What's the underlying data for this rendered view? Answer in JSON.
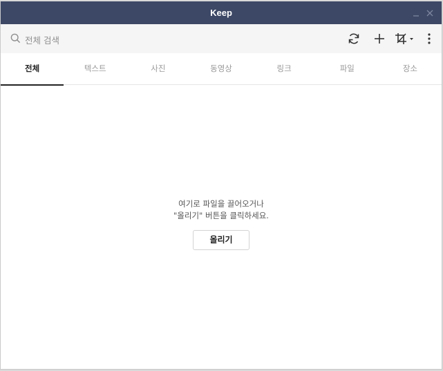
{
  "window": {
    "title": "Keep"
  },
  "search": {
    "placeholder": "전체 검색"
  },
  "toolbar": {
    "icons": [
      "refresh-icon",
      "plus-icon",
      "crop-icon",
      "more-vertical-icon"
    ]
  },
  "tabs": [
    {
      "label": "전체",
      "active": true
    },
    {
      "label": "텍스트",
      "active": false
    },
    {
      "label": "사진",
      "active": false
    },
    {
      "label": "동영상",
      "active": false
    },
    {
      "label": "링크",
      "active": false
    },
    {
      "label": "파일",
      "active": false
    },
    {
      "label": "장소",
      "active": false
    }
  ],
  "empty_state": {
    "line1": "여기로 파일을 끌어오거나",
    "line2": "\"올리기\" 버튼을 클릭하세요.",
    "upload_label": "올리기"
  },
  "colors": {
    "titlebar": "#3d4866",
    "toolbar": "#f5f5f6",
    "active_tab": "#222222"
  }
}
